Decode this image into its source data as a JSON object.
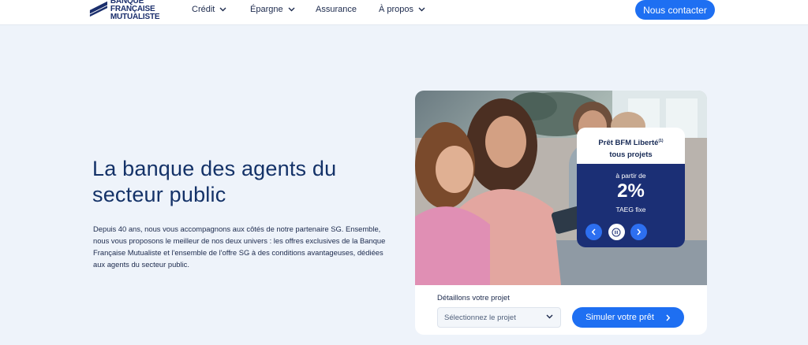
{
  "brand": {
    "line1": "BANQUE FRANÇAISE",
    "line2": "MUTUALISTE"
  },
  "nav": {
    "items": [
      {
        "label": "Crédit",
        "has_chevron": true
      },
      {
        "label": "Épargne",
        "has_chevron": true
      },
      {
        "label": "Assurance",
        "has_chevron": false
      },
      {
        "label": "À propos",
        "has_chevron": true
      }
    ],
    "contact_label": "Nous contacter"
  },
  "hero": {
    "title": "La banque des agents du secteur public",
    "description": "Depuis 40 ans, nous vous accompagnons aux côtés de notre partenaire SG. Ensemble, nous vous proposons le meilleur de nos deux univers : les offres exclusives de la Banque Française Mutualiste et l'ensemble de l'offre SG à des conditions avantageuses, dédiées aux agents du secteur public."
  },
  "promo": {
    "title": "Prêt BFM Liberté",
    "title_note": "(1)",
    "subtitle": "tous projets",
    "from_label": "à partir de",
    "rate": "2%",
    "rate_type": "TAEG fixe"
  },
  "project": {
    "label": "Détaillons votre projet",
    "select_value": "Sélectionnez le projet",
    "simulate_label": "Simuler votre prêt"
  },
  "colors": {
    "primary": "#1e6ff2",
    "navy": "#1b2f75",
    "background": "#eef3fa"
  }
}
